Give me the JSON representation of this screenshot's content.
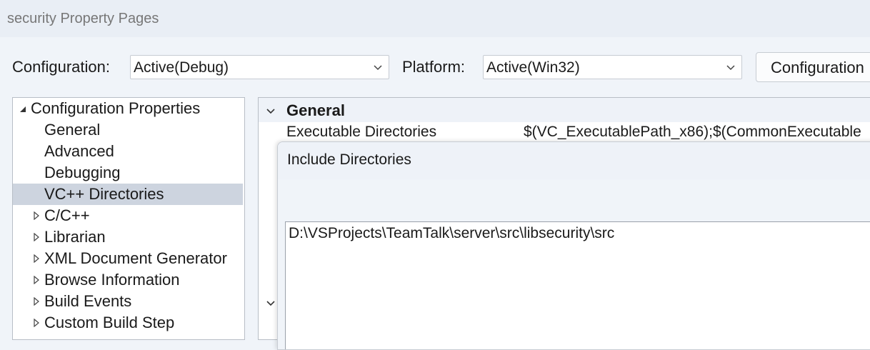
{
  "window": {
    "title": "security Property Pages"
  },
  "toolbar": {
    "configuration_label": "Configuration:",
    "configuration_value": "Active(Debug)",
    "platform_label": "Platform:",
    "platform_value": "Active(Win32)",
    "configuration_manager_label": "Configuration"
  },
  "tree": {
    "root": "Configuration Properties",
    "items": [
      {
        "label": "General"
      },
      {
        "label": "Advanced"
      },
      {
        "label": "Debugging"
      },
      {
        "label": "VC++ Directories",
        "selected": true
      },
      {
        "label": "C/C++"
      },
      {
        "label": "Librarian"
      },
      {
        "label": "XML Document Generator"
      },
      {
        "label": "Browse Information"
      },
      {
        "label": "Build Events"
      },
      {
        "label": "Custom Build Step"
      }
    ]
  },
  "grid": {
    "section_title": "General",
    "rows": [
      {
        "name": "Executable Directories",
        "value": "$(VC_ExecutablePath_x86);$(CommonExecutable"
      }
    ]
  },
  "dialog": {
    "title": "Include Directories",
    "value": "D:\\VSProjects\\TeamTalk\\server\\src\\libsecurity\\src"
  },
  "colors": {
    "selection": "#cdd4df",
    "background": "#f0f4f9"
  }
}
